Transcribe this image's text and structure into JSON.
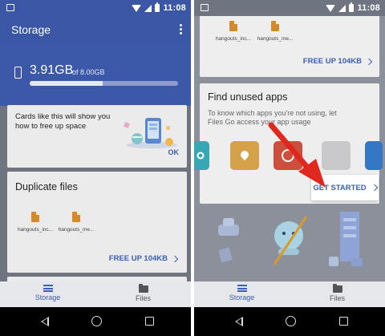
{
  "status_bar": {
    "time": "11:08"
  },
  "left_screen": {
    "app_title": "Storage",
    "storage": {
      "used": "3.91GB",
      "total": "of 8.00GB",
      "used_fraction": 0.49
    },
    "tip_card": {
      "text": "Cards like this will show you how to free up space",
      "ok_label": "OK"
    },
    "duplicate_card": {
      "title": "Duplicate files",
      "files": [
        {
          "name": "hangouts_inc..."
        },
        {
          "name": "hangouts_me..."
        }
      ],
      "free_up_label": "FREE UP 104KB"
    }
  },
  "right_screen": {
    "files_card": {
      "files": [
        {
          "name": "hangouts_inc..."
        },
        {
          "name": "hangouts_me..."
        }
      ],
      "free_up_label": "FREE UP 104KB"
    },
    "unused_card": {
      "title": "Find unused apps",
      "description": "To know which apps you're not using, let Files Go access your app usage",
      "get_started_label": "GET STARTED"
    }
  },
  "tabs": [
    {
      "label": "Storage",
      "icon": "storage-icon",
      "active": true
    },
    {
      "label": "Files",
      "icon": "folder-icon",
      "active": false
    }
  ],
  "colors": {
    "primary": "#3b56a4",
    "accent": "#3b5fb2",
    "arrow": "#e0281f"
  }
}
